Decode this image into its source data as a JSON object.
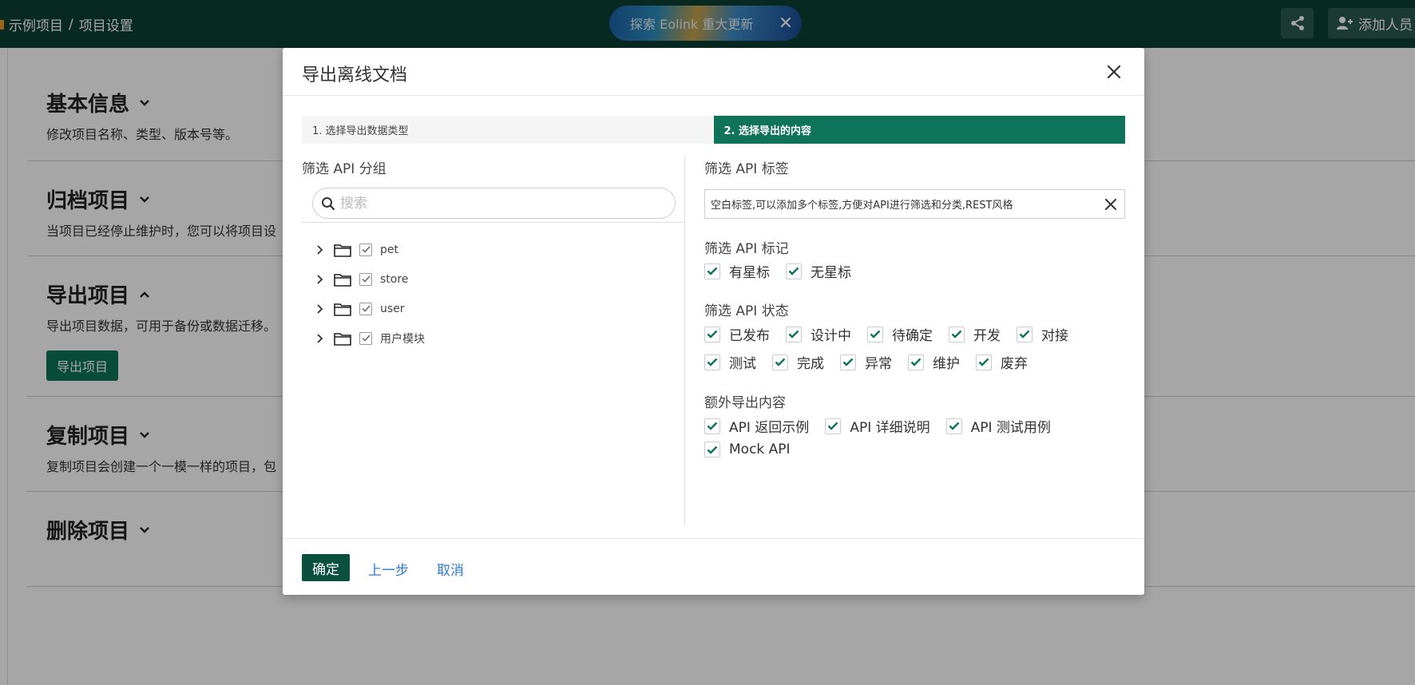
{
  "topbar": {
    "crumb_project": "示例项目",
    "crumb_sep": "/",
    "crumb_page": "项目设置",
    "banner_text": "探索 Eolink 重大更新",
    "add_member_label": "添加人员"
  },
  "settings": {
    "basic": {
      "title": "基本信息",
      "desc": "修改项目名称、类型、版本号等。"
    },
    "archive": {
      "title": "归档项目",
      "desc": "当项目已经停止维护时，您可以将项目设"
    },
    "export": {
      "title": "导出项目",
      "desc": "导出项目数据，可用于备份或数据迁移。",
      "button": "导出项目"
    },
    "copy": {
      "title": "复制项目",
      "desc": "复制项目会创建一个一模一样的项目，包"
    },
    "delete": {
      "title": "删除项目"
    }
  },
  "modal": {
    "title": "导出离线文档",
    "steps": [
      "1. 选择导出数据类型",
      "2. 选择导出的内容"
    ],
    "left": {
      "label": "筛选 API 分组",
      "search_placeholder": "搜索",
      "groups": [
        "pet",
        "store",
        "user",
        "用户模块"
      ]
    },
    "right": {
      "tag_label": "筛选 API 标签",
      "tag_value": "空白标签,可以添加多个标签,方便对API进行筛选和分类,REST风格",
      "mark_label": "筛选 API 标记",
      "marks": [
        "有星标",
        "无星标"
      ],
      "status_label": "筛选 API 状态",
      "status_row1": [
        "已发布",
        "设计中",
        "待确定",
        "开发",
        "对接"
      ],
      "status_row2": [
        "测试",
        "完成",
        "异常",
        "维护",
        "废弃"
      ],
      "extra_label": "额外导出内容",
      "extra_row1": [
        "API 返回示例",
        "API 详细说明",
        "API 测试用例"
      ],
      "extra_row2": [
        "Mock API"
      ]
    },
    "footer": {
      "ok": "确定",
      "prev": "上一步",
      "cancel": "取消"
    }
  },
  "colors": {
    "brand": "#0e7358",
    "topbar": "#0b3f33",
    "link": "#2e7bd6"
  }
}
